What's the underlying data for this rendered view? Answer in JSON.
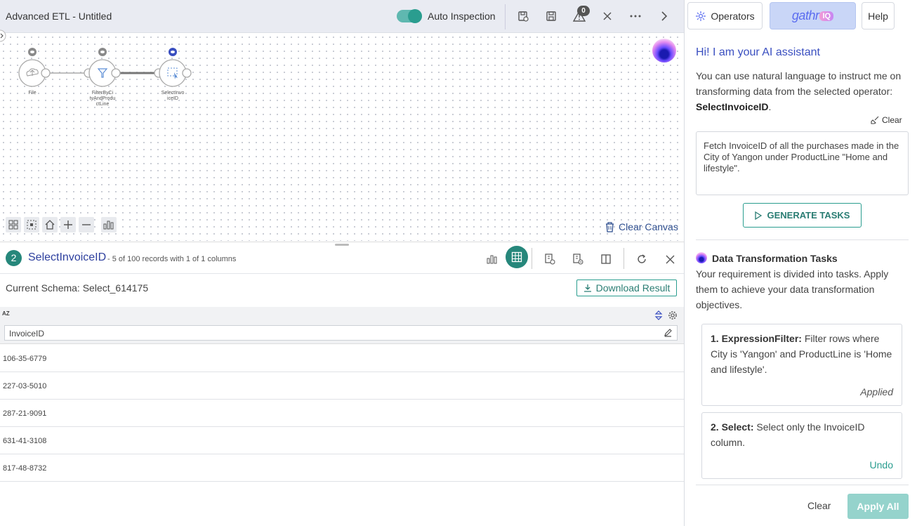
{
  "app": {
    "title": "Advanced ETL - Untitled"
  },
  "topbar": {
    "auto_inspection_label": "Auto Inspection",
    "auto_inspection_on": true,
    "warnings_count": "0"
  },
  "canvas": {
    "nodes": [
      {
        "label_lines": [
          "File"
        ],
        "icon": "cloud-upload-icon"
      },
      {
        "label_lines": [
          "FilterByCi",
          "tyAndProdu",
          "ctLine"
        ],
        "icon": "filter-icon"
      },
      {
        "label_lines": [
          "SelectInvo",
          "iceID"
        ],
        "icon": "select-icon"
      }
    ],
    "clear_label": "Clear Canvas"
  },
  "result": {
    "step_number": "2",
    "title": "SelectInvoiceID",
    "subtitle": "- 5 of 100 records with 1 of 1 columns",
    "schema_label": "Current Schema: Select_614175",
    "download_label": "Download Result",
    "type_glyph": "AZ",
    "column_name": "InvoiceID",
    "rows": [
      "106-35-6779",
      "227-03-5010",
      "287-21-9091",
      "631-41-3108",
      "817-48-8732"
    ]
  },
  "right_panel": {
    "tabs": {
      "operators": "Operators",
      "gathr_word": "gathr",
      "gathr_iq": "IQ",
      "help": "Help"
    },
    "greeting": "Hi! I am your AI assistant",
    "desc_intro": "You can use natural language to instruct me on transforming data from the selected operator:",
    "desc_operator": "SelectInvoiceID",
    "desc_end": ".",
    "clear_label": "Clear",
    "prompt": "Fetch InvoiceID of all the purchases made in the City of Yangon under ProductLine \"Home and lifestyle\".",
    "generate_label": "GENERATE TASKS",
    "tasks_title": "Data Transformation Tasks",
    "tasks_desc": "Your requirement is divided into tasks. Apply them to achieve your data transformation objectives.",
    "tasks": [
      {
        "heading": "1. ExpressionFilter:",
        "text": "Filter rows where City is 'Yangon' and ProductLine is 'Home and lifestyle'.",
        "status": "Applied"
      },
      {
        "heading": "2. Select:",
        "text": "Select only the InvoiceID column.",
        "status": "Undo"
      }
    ],
    "footer_clear": "Clear",
    "apply_all": "Apply All"
  },
  "colors": {
    "accent": "#2a9d8f",
    "link_blue": "#2d3f9e",
    "apply_disabled": "#95d3cc"
  }
}
